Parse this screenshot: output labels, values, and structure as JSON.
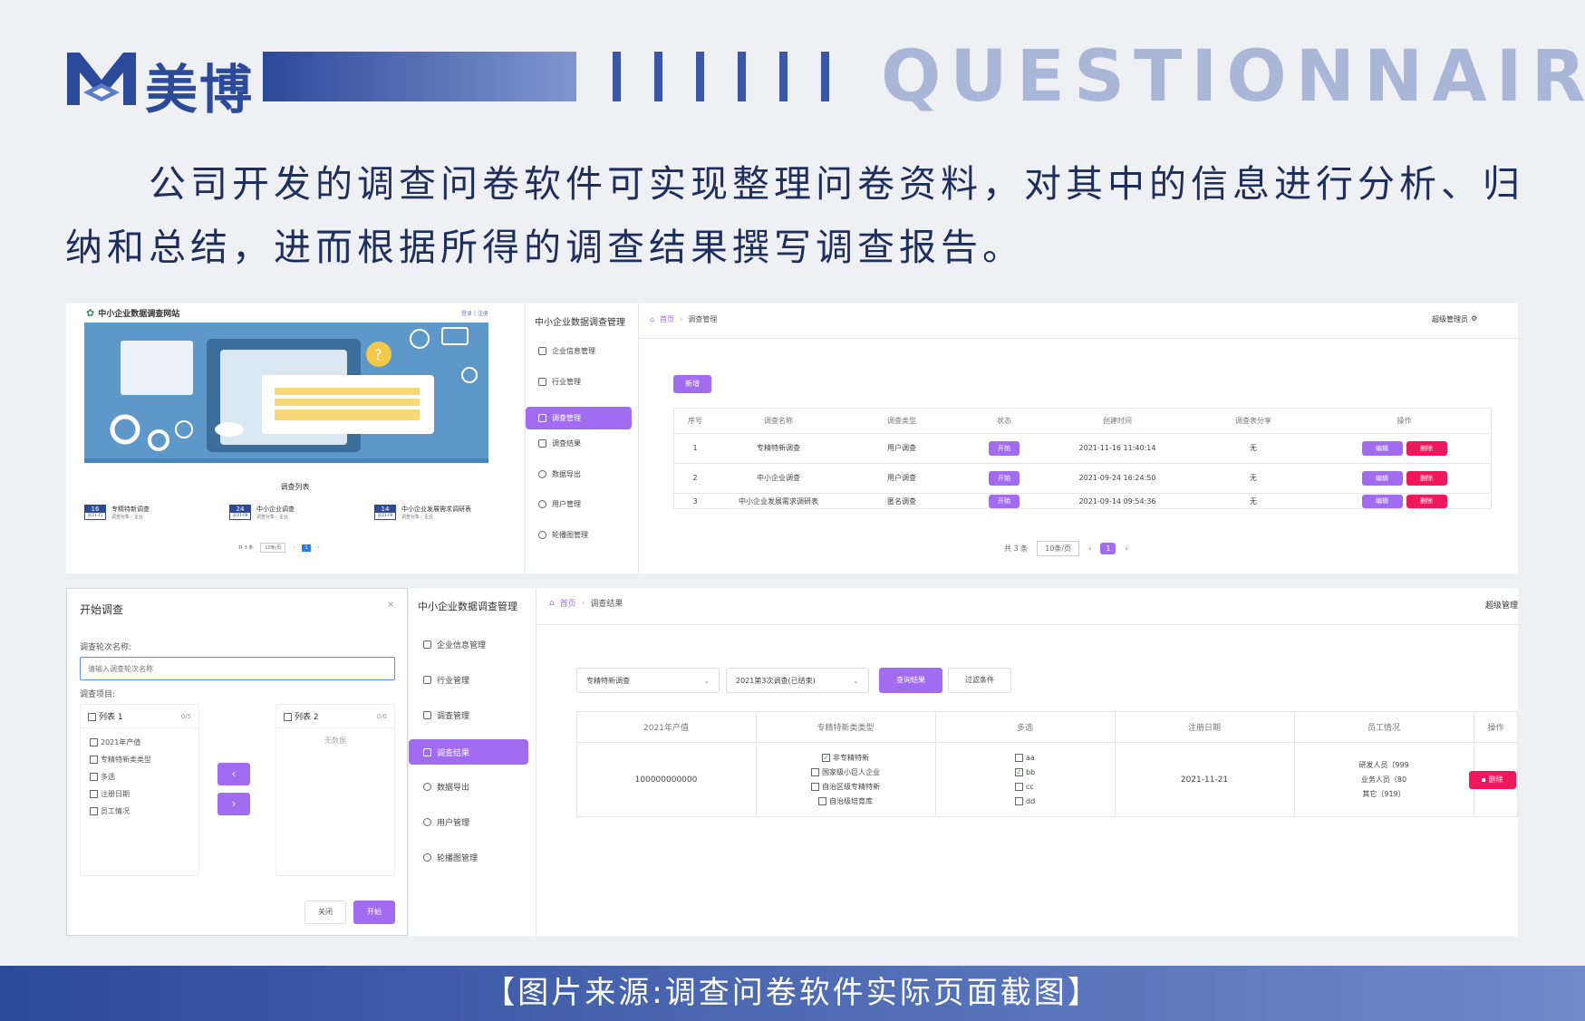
{
  "brand": {
    "name": "美博",
    "title": "QUESTIONNAIRE"
  },
  "intro": "公司开发的调查问卷软件可实现整理问卷资料，对其中的信息进行分析、归纳和总结，进而根据所得的调查结果撰写调查报告。",
  "footer": "【图片来源:调查问卷软件实际页面截图】",
  "site": {
    "name": "中小企业数据调查网站",
    "user_link": "登录 | 注册",
    "list_title": "调查列表",
    "cards": [
      {
        "day": "16",
        "date": "2021-11",
        "name": "专精特新调查",
        "target": "调查对象：企业"
      },
      {
        "day": "24",
        "date": "2021-09",
        "name": "中小企业调查",
        "target": "调查对象：企业"
      },
      {
        "day": "14",
        "date": "2021-09",
        "name": "中小企业发展需求调研表",
        "target": "调查对象：企业"
      }
    ],
    "pager_total": "共 3 条",
    "pager_size": "10条/页",
    "pager_page": "1"
  },
  "admin": {
    "app_title": "中小企业数据调查管理",
    "menu": [
      "企业信息管理",
      "行业管理",
      "调查管理",
      "调查结果",
      "数据导出",
      "用户管理",
      "轮播图管理"
    ],
    "breadcrumb_home": "首页",
    "breadcrumb_current": "调查管理",
    "user": "超级管理员",
    "add_button": "新增",
    "columns": [
      "序号",
      "调查名称",
      "调查类型",
      "状态",
      "创建时间",
      "调查表分享",
      "操作"
    ],
    "rows": [
      {
        "idx": "1",
        "name": "专精特新调查",
        "type": "用户调查",
        "status": "开始",
        "created": "2021-11-16 11:40:14",
        "share": "无"
      },
      {
        "idx": "2",
        "name": "中小企业调查",
        "type": "用户调查",
        "status": "开始",
        "created": "2021-09-24 16:24:50",
        "share": "无"
      },
      {
        "idx": "3",
        "name": "中小企业发展需求调研表",
        "type": "匿名调查",
        "status": "开始",
        "created": "2021-09-14 09:54:36",
        "share": "无"
      }
    ],
    "edit_label": "编辑",
    "delete_label": "删除",
    "pager_total": "共 3 条",
    "pager_size": "10条/页",
    "pager_page": "1"
  },
  "dialog": {
    "title": "开始调查",
    "round_label": "调查轮次名称:",
    "round_placeholder": "请输入调查轮次名称",
    "items_label": "调查项目:",
    "list1_title": "列表 1",
    "list1_count": "0/5",
    "list1_items": [
      "2021年产值",
      "专精特新类类型",
      "多选",
      "注册日期",
      "员工情况"
    ],
    "list2_title": "列表 2",
    "list2_count": "0/0",
    "list2_empty": "无数据",
    "close_button": "关闭",
    "start_button": "开始"
  },
  "results": {
    "app_title": "中小企业数据调查管理",
    "breadcrumb_home": "首页",
    "breadcrumb_current": "调查结果",
    "user": "超级管理",
    "survey_select": "专精特新调查",
    "round_select": "2021第3次调查(已结束)",
    "query_button": "查询结果",
    "filter_button": "过滤条件",
    "columns": [
      "2021年产值",
      "专精特新类类型",
      "多选",
      "注册日期",
      "员工情况",
      "操作"
    ],
    "row": {
      "output": "100000000000",
      "types": [
        {
          "label": "非专精特新",
          "checked": true
        },
        {
          "label": "国家级小巨人企业",
          "checked": false
        },
        {
          "label": "自治区级专精特新",
          "checked": false
        },
        {
          "label": "自治级培育库",
          "checked": false
        }
      ],
      "multi": [
        {
          "label": "aa",
          "checked": false
        },
        {
          "label": "bb",
          "checked": true
        },
        {
          "label": "cc",
          "checked": false
        },
        {
          "label": "dd",
          "checked": false
        }
      ],
      "reg_date": "2021-11-21",
      "staff": [
        "研发人员（999",
        "业务人员（80",
        "其它（919）"
      ],
      "delete_label": "删除"
    }
  },
  "colors": {
    "primary": "#2c4a9a",
    "accent": "#a26cf0",
    "danger": "#f0185c"
  }
}
